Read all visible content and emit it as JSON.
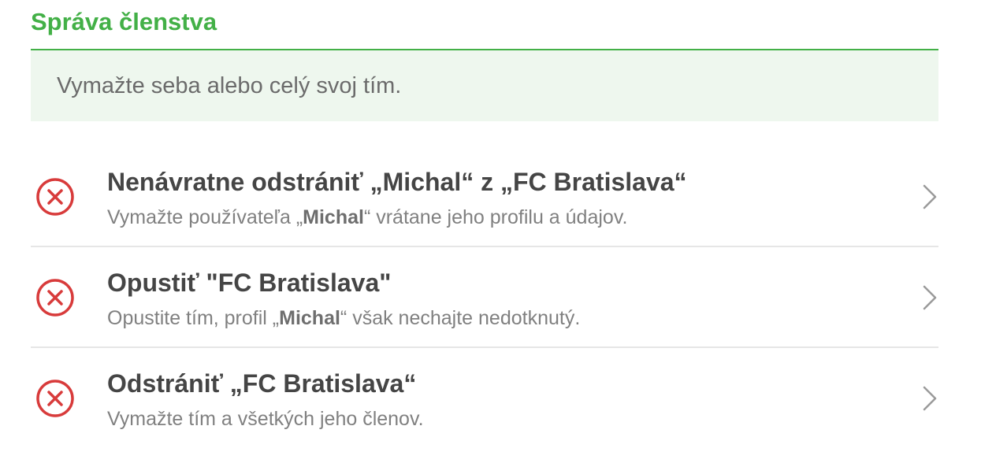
{
  "section": {
    "title": "Správa členstva",
    "subtitle": "Vymažte seba alebo celý svoj tím.",
    "accent_color": "#43b047",
    "info_bg_color": "#eef7ee"
  },
  "actions": [
    {
      "title": "Nenávratne odstrániť „Michal“ z „FC Bratislava“",
      "desc_before": "Vymažte používateľa „",
      "desc_name": "Michal",
      "desc_after": "“ vrátane jeho profilu a údajov.",
      "icon": "close-circle-icon",
      "icon_color": "#d83b3b"
    },
    {
      "title": "Opustiť \"FC Bratislava\"",
      "desc_before": "Opustite tím, profil „",
      "desc_name": "Michal",
      "desc_after": "“ však nechajte nedotknutý.",
      "icon": "close-circle-icon",
      "icon_color": "#d83b3b"
    },
    {
      "title": "Odstrániť „FC Bratislava“",
      "desc_before": "Vymažte tím a všetkých jeho členov.",
      "desc_name": "",
      "desc_after": "",
      "icon": "close-circle-icon",
      "icon_color": "#d83b3b"
    }
  ]
}
